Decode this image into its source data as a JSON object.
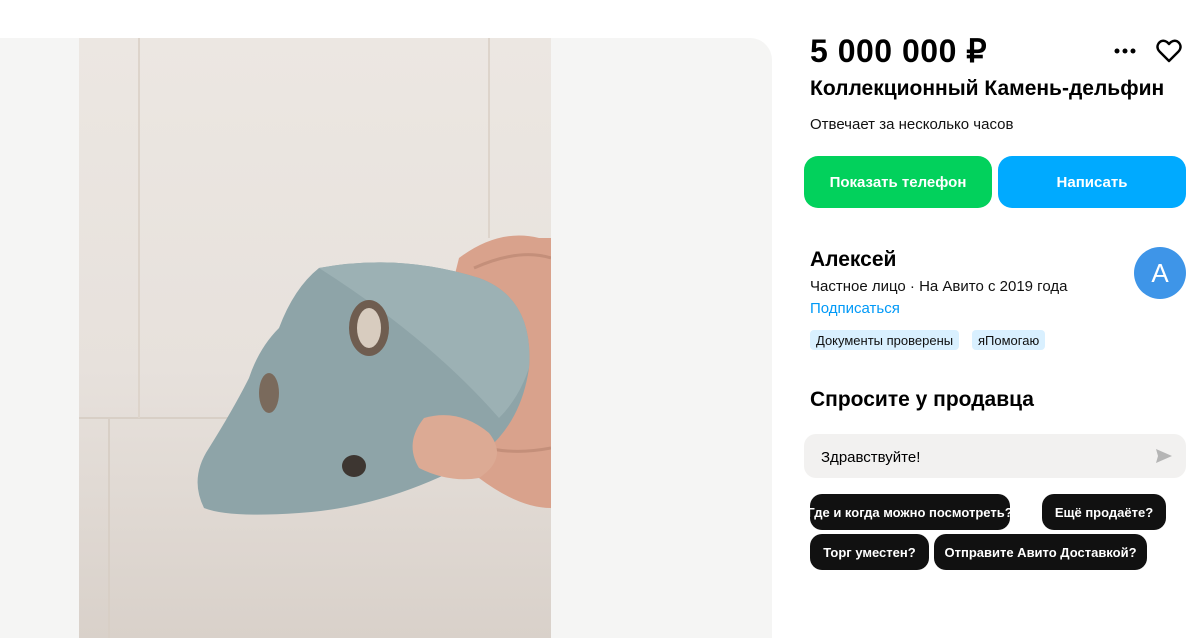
{
  "listing": {
    "price": "5 000 000 ₽",
    "title": "Коллекционный Камень-дельфин",
    "response_time": "Отвечает за несколько часов"
  },
  "actions": {
    "show_phone": "Показать телефон",
    "write": "Написать"
  },
  "seller": {
    "name": "Алексей",
    "meta": "Частное лицо · На Авито с 2019 года",
    "subscribe": "Подписаться",
    "avatar_letter": "А",
    "badges": [
      "Документы проверены",
      "яПомогаю"
    ]
  },
  "ask": {
    "title": "Спросите у продавца",
    "input_value": "Здравствуйте!",
    "quick_questions": [
      "Где и когда можно посмотреть?",
      "Ещё продаёте?",
      "Торг уместен?",
      "Отправите Авито Доставкой?"
    ]
  },
  "colors": {
    "phone_button": "#02d15c",
    "write_button": "#00aaff",
    "link": "#0099f7",
    "avatar": "#3e95e8",
    "badge_bg": "#d9f0ff"
  },
  "icons": [
    "more-icon",
    "heart-icon",
    "send-icon"
  ]
}
